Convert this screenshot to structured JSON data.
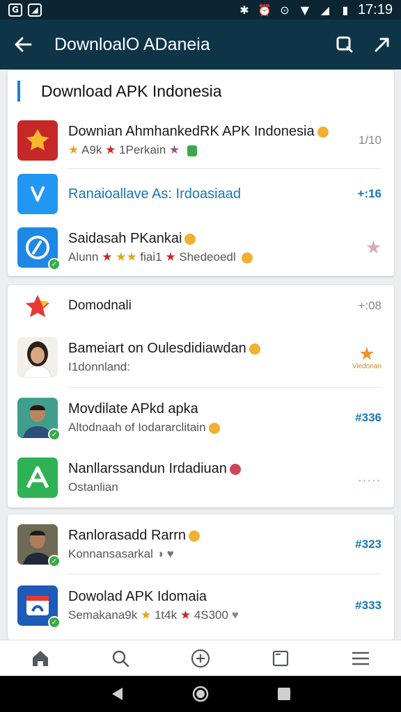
{
  "status_bar": {
    "time": "17:19",
    "left_icons": [
      "notification-icon",
      "image-icon"
    ],
    "right_icons": [
      "bluetooth-icon",
      "alarm-icon",
      "sync-icon",
      "wifi-icon",
      "signal-icon",
      "battery-icon"
    ]
  },
  "app_bar": {
    "title": "DownloalO ADaneia"
  },
  "card1": {
    "header": "Download APK Indonesia",
    "items": [
      {
        "title": "Downian AhmhankedRK APK Indonesia",
        "subtitle_parts": [
          "★",
          "A9k",
          "★",
          "1Perkain",
          "★"
        ],
        "meta": "1/10"
      },
      {
        "title": "Ranaioallave As: Irdoasiaad",
        "meta": "+:16"
      },
      {
        "title": "Saidasah PKankai",
        "subtitle_parts": [
          "Alunn",
          "★",
          "★★",
          "fiai1",
          "★",
          "Shedeoedl"
        ],
        "meta": "★"
      }
    ]
  },
  "card2": {
    "items": [
      {
        "title": "Domodnali",
        "meta": "+:08"
      },
      {
        "title": "Bameiart on Oulesdidiawdan",
        "subtitle": "I1donnland:",
        "meta_label": "Viedonan"
      },
      {
        "title": "Movdilate APkd apka",
        "subtitle": "Altodnaah of Iodararclitain",
        "meta": "#336"
      },
      {
        "title": "Nanllarssandun Irdadiuan",
        "subtitle": "Ostanlian",
        "meta": "....."
      }
    ]
  },
  "card3": {
    "items": [
      {
        "title": "Ranlorasadd Rarrn",
        "subtitle": "Konnansasarkal",
        "meta": "#323"
      },
      {
        "title": "Dowolad APK Idomaia",
        "subtitle_parts": [
          "Semakana9k",
          "★",
          "1t4k",
          "★",
          "4S300"
        ],
        "meta": "#333"
      }
    ]
  },
  "bottom_nav": [
    "home-icon",
    "search-icon",
    "add-icon",
    "square-icon",
    "menu-icon"
  ],
  "colors": {
    "app_bar": "#0e3447",
    "status_bar": "#0b2533",
    "accent": "#1a7fd6"
  }
}
